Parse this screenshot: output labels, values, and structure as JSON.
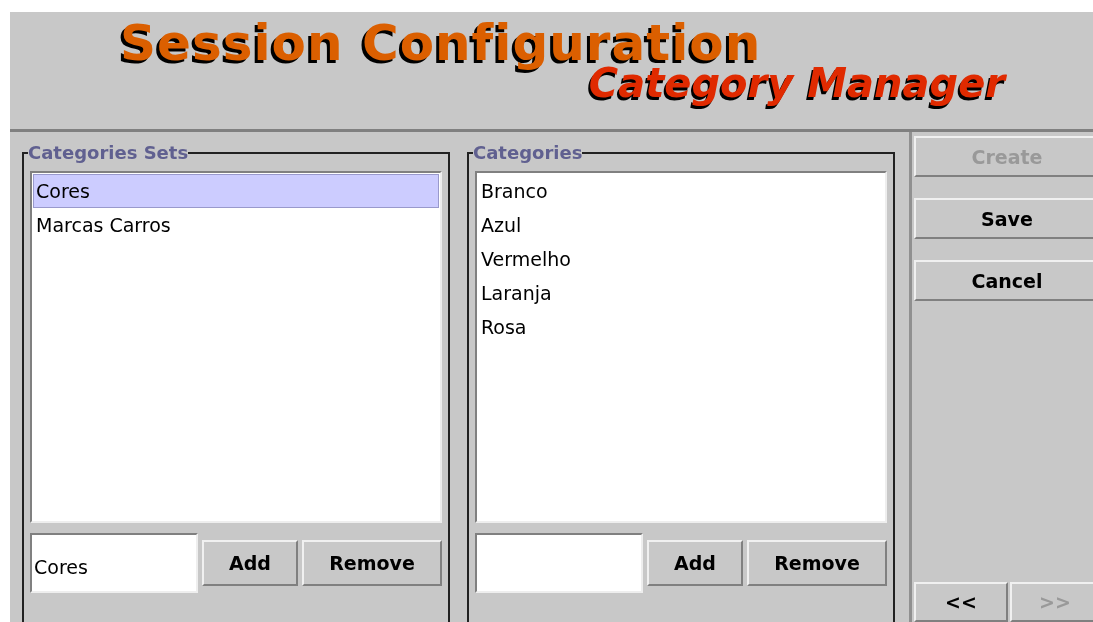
{
  "header": {
    "title": "Session Configuration",
    "subtitle": "Category Manager"
  },
  "panels": [
    {
      "legend": "Categories Sets",
      "items": [
        {
          "label": "Cores",
          "selected": true
        },
        {
          "label": "Marcas Carros",
          "selected": false
        }
      ],
      "input": {
        "value": "Cores"
      },
      "buttons": [
        "Add",
        "Remove"
      ]
    },
    {
      "legend": "Categories",
      "items": [
        {
          "label": "Branco",
          "selected": false
        },
        {
          "label": "Azul",
          "selected": false
        },
        {
          "label": "Vermelho",
          "selected": false
        },
        {
          "label": "Laranja",
          "selected": false
        },
        {
          "label": "Rosa",
          "selected": false
        }
      ],
      "buttons": [
        "Add",
        "Remove"
      ]
    }
  ],
  "actions": [
    {
      "label": "Create",
      "disabled": true
    },
    {
      "label": "Save",
      "disabled": false
    },
    {
      "label": "Cancel",
      "disabled": false
    }
  ],
  "nav": [
    {
      "label": "<<",
      "disabled": false
    },
    {
      "label": ">>",
      "disabled": true
    }
  ]
}
